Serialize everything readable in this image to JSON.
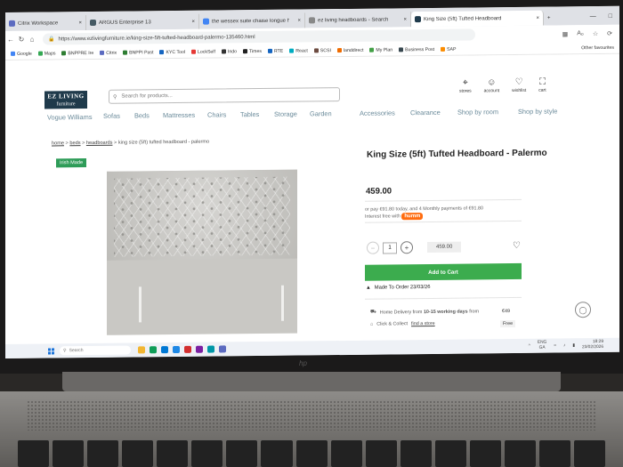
{
  "browser": {
    "tabs": [
      {
        "label": "Citrix Workspace",
        "color": "#5c6bc0"
      },
      {
        "label": "ARGUS Enterprise 13",
        "color": "#455a64"
      },
      {
        "label": "the wessex suite chaise longue h",
        "color": "#4285f4"
      },
      {
        "label": "ez living headboards - Search",
        "color": "#888888"
      },
      {
        "label": "King Size (5ft) Tufted Headboard",
        "color": "#1f3a4b",
        "active": true
      }
    ],
    "new_tab": "+",
    "url": "https://www.ezlivingfurniture.ie/king-size-5ft-tufted-headboard-palermo-135460.html",
    "other_favourites": "Other favourites",
    "bookmarks": [
      {
        "label": "Google",
        "color": "#4285f4"
      },
      {
        "label": "Maps",
        "color": "#34a853"
      },
      {
        "label": "BNPPRE Ire",
        "color": "#2e7d32"
      },
      {
        "label": "Citrix",
        "color": "#5c6bc0"
      },
      {
        "label": "BNPPI Past",
        "color": "#2e7d32"
      },
      {
        "label": "KYC Tool",
        "color": "#1565c0"
      },
      {
        "label": "LockSelf",
        "color": "#e53935"
      },
      {
        "label": "Indo",
        "color": "#333333"
      },
      {
        "label": "Times",
        "color": "#222222"
      },
      {
        "label": "RTE",
        "color": "#1565c0"
      },
      {
        "label": "React",
        "color": "#00acc1"
      },
      {
        "label": "SCSI",
        "color": "#6d4c41"
      },
      {
        "label": "landdirect",
        "color": "#ef6c00"
      },
      {
        "label": "My Plan",
        "color": "#43a047"
      },
      {
        "label": "Business Post",
        "color": "#37474f"
      },
      {
        "label": "SAP",
        "color": "#fb8c00"
      }
    ]
  },
  "site": {
    "logo_top": "EZ LIVING",
    "logo_bottom": "furniture",
    "search_placeholder": "Search for products...",
    "header_icons": [
      {
        "label": "stores",
        "icon": "pin-icon"
      },
      {
        "label": "account",
        "icon": "user-icon"
      },
      {
        "label": "wishlist",
        "icon": "heart-icon"
      },
      {
        "label": "cart",
        "icon": "bag-icon"
      }
    ],
    "menu": [
      "Vogue Williams",
      "Sofas",
      "Beds",
      "Mattresses",
      "Chairs",
      "Tables",
      "Storage",
      "Garden",
      "Accessories",
      "Clearance",
      "Shop by room",
      "Shop by style"
    ]
  },
  "product": {
    "breadcrumb": [
      "home",
      "beds",
      "headboards",
      "king size (5ft) tufted headboard - palermo"
    ],
    "badge": "Irish Made",
    "title": "King Size (5ft) Tufted Headboard - Palermo",
    "price": "459.00",
    "pay_line": "or pay €91.80 today, and 4 Monthly payments of €91.80",
    "interest_line": "Interest free with",
    "humm_label": "humm",
    "qty": "1",
    "line_price": "459.00",
    "add_to_cart": "Add to Cart",
    "made_to_order": "Made To Order 23/03/26",
    "delivery_prefix": "Home Delivery from",
    "delivery_days": "10-15 working days",
    "delivery_suffix": "from",
    "delivery_price": "€49",
    "click_collect_prefix": "Click & Collect",
    "find_store": "find a store",
    "click_collect_price": "Free"
  },
  "taskbar": {
    "search_placeholder": "Search",
    "lang_top": "ENG",
    "lang_bottom": "GA",
    "time": "18:29",
    "date": "23/02/2026"
  },
  "laptop": {
    "brand": "hp"
  }
}
